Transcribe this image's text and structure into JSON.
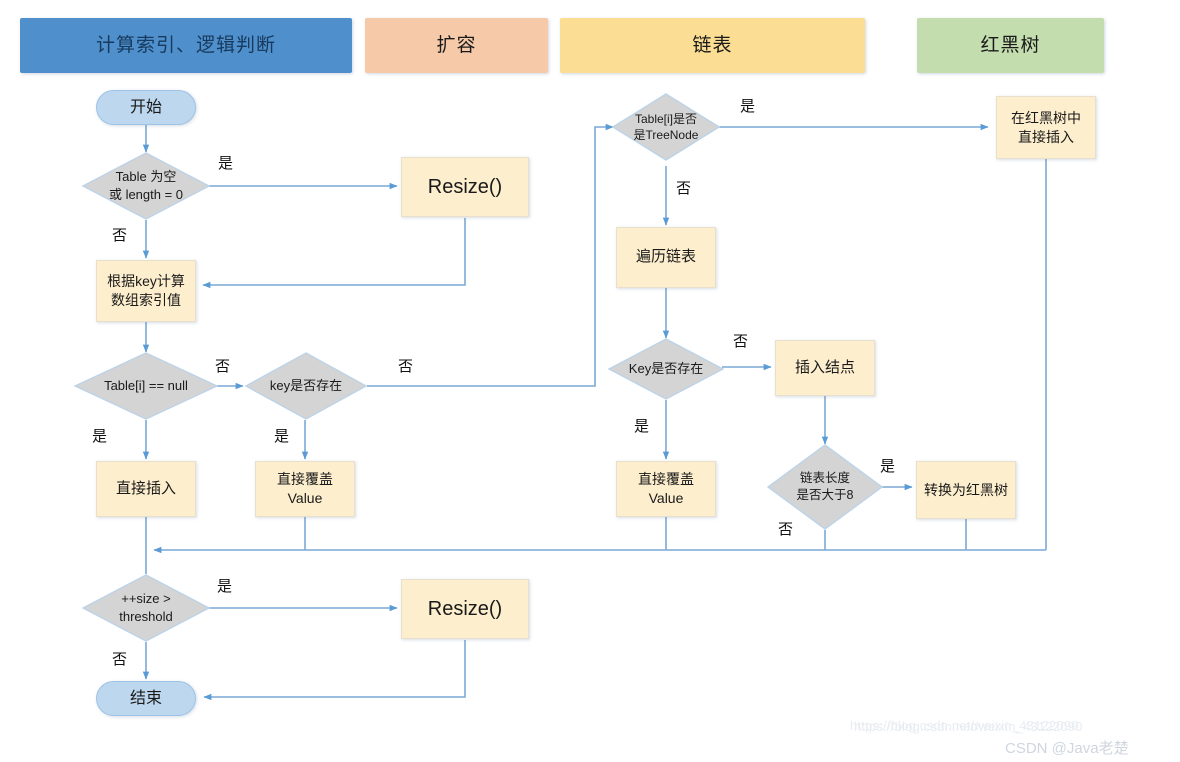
{
  "diagram": {
    "title_columns": [
      {
        "label": "计算索引、逻辑判断",
        "color": "#4f8fcb",
        "text_color": "#173a5e"
      },
      {
        "label": "扩容",
        "color": "#f6c9a8",
        "text_color": "#1a1a1a"
      },
      {
        "label": "链表",
        "color": "#fbdd93",
        "text_color": "#1a1a1a"
      },
      {
        "label": "红黑树",
        "color": "#c3ddaf",
        "text_color": "#1a1a1a"
      }
    ],
    "nodes": {
      "start": "开始",
      "table_empty": "Table 为空\n或 length = 0",
      "resize_top": "Resize()",
      "calc_index": "根据key计算\n数组索引值",
      "table_i_null": "Table[i] == null",
      "key_exists": "key是否存在",
      "insert_direct": "直接插入",
      "overwrite_value_left": "直接覆盖\nValue",
      "size_threshold": "++size >\nthreshold",
      "resize_bottom": "Resize()",
      "end": "结束",
      "is_treenode": "Table[i]是否\n是TreeNode",
      "traverse_list": "遍历链表",
      "key_exists_list": "Key是否存在",
      "overwrite_value_mid": "直接覆盖\nValue",
      "insert_node": "插入结点",
      "list_length_gt8": "链表长度\n是否大于8",
      "convert_to_tree": "转换为红黑树",
      "insert_in_rbtree": "在红黑树中\n直接插入"
    },
    "edge_labels": {
      "yes": "是",
      "no": "否"
    },
    "colors": {
      "process_fill": "#fdeecd",
      "process_stroke": "#e8e0cc",
      "decision_fill": "#d4d4d4",
      "decision_stroke": "#bcd3e8",
      "terminator_fill": "#bdd7ee",
      "terminator_stroke": "#9dc3e6",
      "connector": "#7aa9d6",
      "arrow": "#5b9bd5"
    }
  },
  "watermark": {
    "url": "https://blog.csdn.net/weixin_43122090",
    "credit": "CSDN @Java老楚"
  }
}
